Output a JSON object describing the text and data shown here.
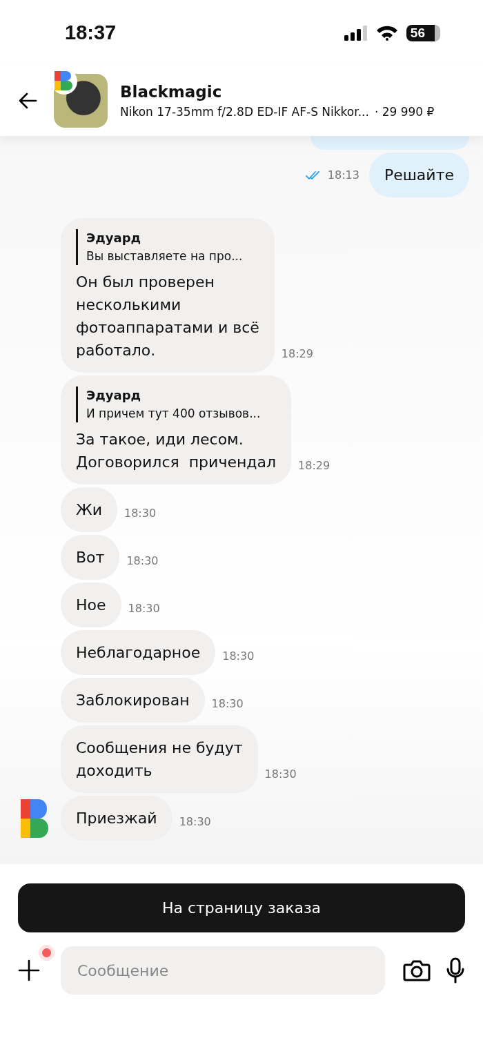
{
  "status_bar": {
    "time": "18:37",
    "battery": "56"
  },
  "header": {
    "title": "Blackmagic",
    "product": "Nikon 17-35mm f/2.8D ED-IF AF-S Nikkor...",
    "price": "· 29 990 ₽"
  },
  "messages": [
    {
      "kind": "outgoing",
      "text": "Решайте",
      "time": "18:13",
      "read": true
    },
    {
      "kind": "incoming",
      "quote_author": "Эдуард",
      "quote_text": "Вы выставляете на про...",
      "text": "Он был проверен\nнесколькими\nфотоаппаратами и всё\nработало.",
      "time": "18:29",
      "show_avatar": false
    },
    {
      "kind": "incoming",
      "quote_author": "Эдуард",
      "quote_text": "И причем тут 400 отзывов...",
      "text": "За такое, иди лесом.\nДоговорился  причендал",
      "time": "18:29",
      "show_avatar": false
    },
    {
      "kind": "incoming",
      "text": "Жи",
      "time": "18:30",
      "show_avatar": false
    },
    {
      "kind": "incoming",
      "text": "Вот",
      "time": "18:30",
      "show_avatar": false
    },
    {
      "kind": "incoming",
      "text": "Ное",
      "time": "18:30",
      "show_avatar": false
    },
    {
      "kind": "incoming",
      "text": "Неблагодарное",
      "time": "18:30",
      "show_avatar": false
    },
    {
      "kind": "incoming",
      "text": "Заблокирован",
      "time": "18:30",
      "show_avatar": false
    },
    {
      "kind": "incoming",
      "text": "Сообщения не будут\nдоходить",
      "time": "18:30",
      "show_avatar": false
    },
    {
      "kind": "incoming",
      "text": "Приезжай",
      "time": "18:30",
      "show_avatar": true
    }
  ],
  "order_button": "На страницу заказа",
  "composer": {
    "placeholder": "Сообщение",
    "attach_notification": true
  }
}
